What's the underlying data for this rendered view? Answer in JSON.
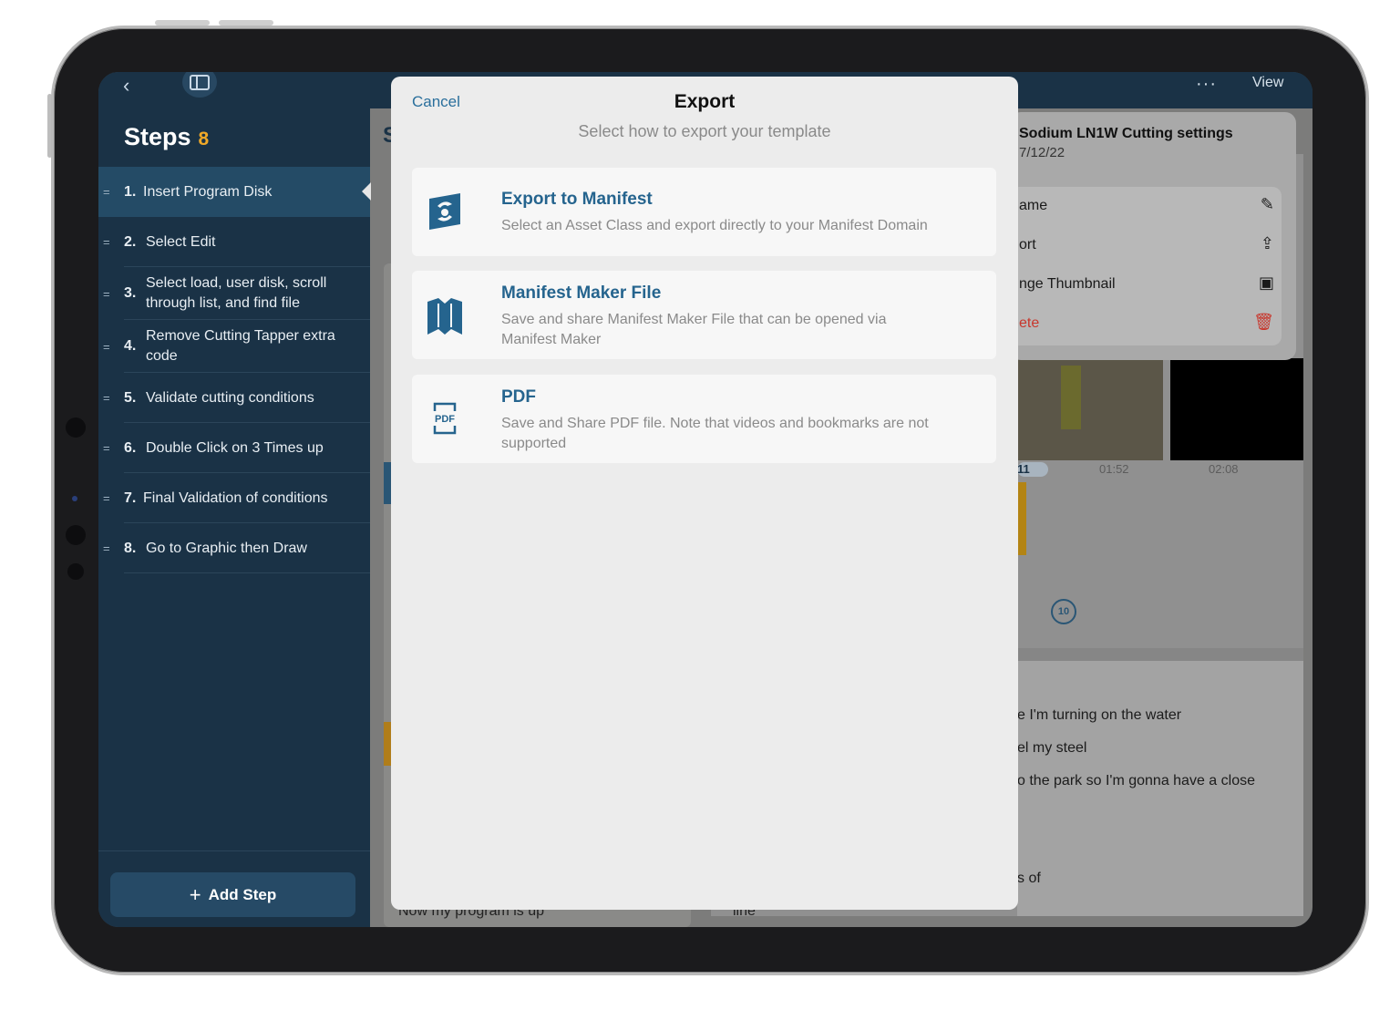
{
  "sidebar": {
    "title": "Steps",
    "count": "8",
    "steps": [
      {
        "num": "1.",
        "label": "Insert Program Disk"
      },
      {
        "num": "2.",
        "label": "Select Edit"
      },
      {
        "num": "3.",
        "label": "Select load, user disk, scroll through list, and find file"
      },
      {
        "num": "4.",
        "label": "Remove Cutting Tapper extra code"
      },
      {
        "num": "5.",
        "label": "Validate cutting conditions"
      },
      {
        "num": "6.",
        "label": "Double Click on 3 Times up"
      },
      {
        "num": "7.",
        "label": "Final Validation of conditions"
      },
      {
        "num": "8.",
        "label": "Go to Graphic then Draw"
      }
    ],
    "add_step_label": "Add Step"
  },
  "topbar": {
    "more_label": "···",
    "view_label": "View"
  },
  "background": {
    "section_letter": "S",
    "caption": "Now my program is up",
    "caption2": "line",
    "timeline": {
      "current": "11",
      "t1": "01:52",
      "t2": "02:08"
    },
    "replay_label": "10",
    "transcript": [
      "e I'm turning on the water",
      "el my steel",
      "o the park so I'm gonna have a close",
      "s of"
    ]
  },
  "menu": {
    "title": "Sodium LN1W Cutting settings",
    "date": "7/12/22",
    "items": [
      {
        "label": "ame",
        "icon": "pencil-icon"
      },
      {
        "label": "ort",
        "icon": "share-icon"
      },
      {
        "label": "nge Thumbnail",
        "icon": "image-icon"
      },
      {
        "label": "ete",
        "icon": "trash-icon"
      }
    ]
  },
  "modal": {
    "cancel_label": "Cancel",
    "title": "Export",
    "subtitle": "Select how to export your template",
    "options": [
      {
        "title": "Export to Manifest",
        "desc": "Select an Asset Class and export directly to your Manifest Domain",
        "icon": "manifest-logo-icon"
      },
      {
        "title": "Manifest Maker File",
        "desc": "Save and share Manifest Maker File that can be opened via Manifest Maker",
        "icon": "manifest-maker-icon"
      },
      {
        "title": "PDF",
        "desc": "Save and Share PDF file. Note that videos and bookmarks are not supported",
        "icon": "pdf-icon"
      }
    ]
  },
  "colors": {
    "sidebar_bg": "#1a3246",
    "accent_blue": "#25648e",
    "count_orange": "#f0a928",
    "delete_red": "#c8372d"
  }
}
